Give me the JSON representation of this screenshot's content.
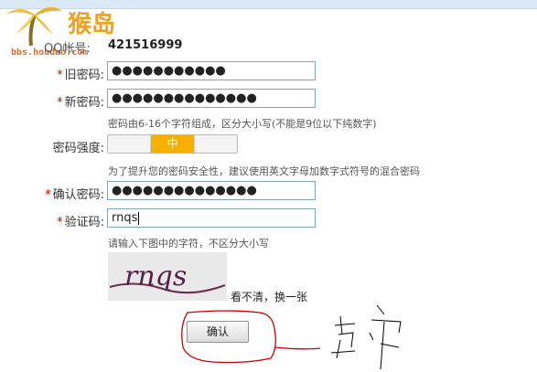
{
  "watermark": {
    "logo_text": "猴岛",
    "domain_text": "bbs.houdao.com"
  },
  "form": {
    "qq": {
      "label": "QQ帐号:",
      "value": "421516999"
    },
    "old_password": {
      "required_mark": "*",
      "label": "旧密码:",
      "value": "●●●●●●●●●●●"
    },
    "new_password": {
      "required_mark": "*",
      "label": "新密码:",
      "value": "●●●●●●●●●●●●●●",
      "hint": "密码由6-16个字符组成，区分大小写(不能是9位以下纯数字)"
    },
    "strength": {
      "label": "密码强度:",
      "level_text": "中",
      "level": 2,
      "levels": 3,
      "hint": "为了提升您的密码安全性，建议使用英文字母加数字式符号的混合密码"
    },
    "confirm_password": {
      "required_mark": "*",
      "label": "确认密码:",
      "value": "●●●●●●●●●●●●●●"
    },
    "captcha": {
      "required_mark": "*",
      "label": "验证码:",
      "value": "rnqs",
      "hint": "请输入下图中的字符，不区分大小写",
      "image_text": "rnqs",
      "refresh_label": "看不清，换一张"
    },
    "submit_label": "确认"
  },
  "annotation": {
    "color": "#cc0000"
  }
}
